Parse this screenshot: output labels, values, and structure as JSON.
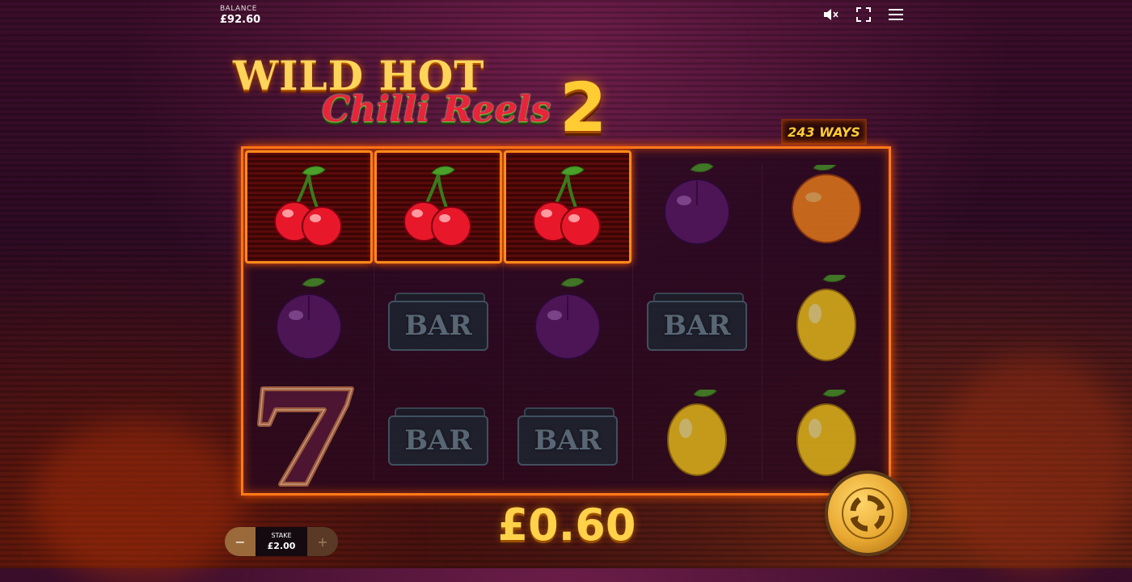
{
  "header": {
    "balance_label": "BALANCE",
    "balance_value": "£92.60",
    "icons": [
      "mute-icon",
      "fullscreen-icon",
      "menu-icon"
    ]
  },
  "logo": {
    "line1": "WILD HOT",
    "line2": "Chilli Reels",
    "line3": "2"
  },
  "ways_badge": "243 WAYS",
  "reels": {
    "columns": [
      [
        "cherry",
        "plum",
        "seven"
      ],
      [
        "cherry",
        "bar",
        "bar"
      ],
      [
        "cherry",
        "plum",
        "bar"
      ],
      [
        "plum",
        "bar",
        "lemon"
      ],
      [
        "orange",
        "lemon",
        "lemon"
      ]
    ],
    "winning_cells": [
      [
        0,
        0
      ],
      [
        1,
        0
      ],
      [
        2,
        0
      ]
    ],
    "bar_label": "BAR"
  },
  "win_amount": "£0.60",
  "stake": {
    "label": "STAKE",
    "value": "£2.00",
    "minus_label": "−",
    "plus_label": "+"
  },
  "colors": {
    "frame": "#ff7a1a",
    "gold": "#ffd24a",
    "cherry": "#e8182a",
    "plum": "#5a1a6a",
    "lemon": "#ffd21a",
    "orange": "#ff8a1a"
  }
}
